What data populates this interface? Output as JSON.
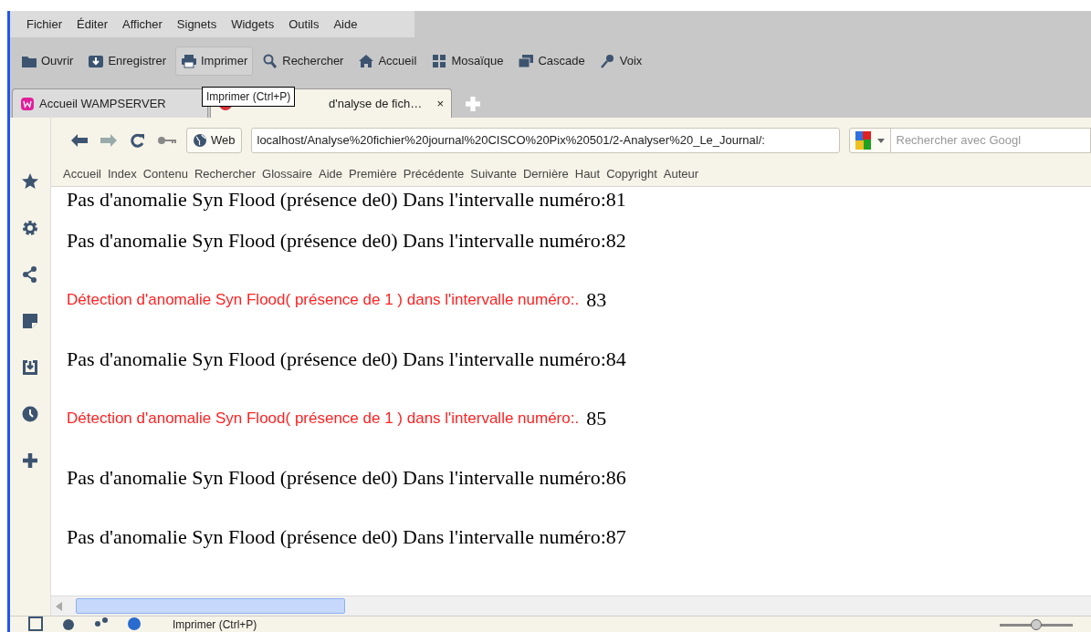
{
  "menu": [
    "Fichier",
    "Éditer",
    "Afficher",
    "Signets",
    "Widgets",
    "Outils",
    "Aide"
  ],
  "toolbar": [
    {
      "kind": "folder",
      "label": "Ouvrir",
      "hover": false
    },
    {
      "kind": "save",
      "label": "Enregistrer",
      "hover": false
    },
    {
      "kind": "print",
      "label": "Imprimer",
      "hover": true
    },
    {
      "kind": "search",
      "label": "Rechercher",
      "hover": false
    },
    {
      "kind": "home",
      "label": "Accueil",
      "hover": false
    },
    {
      "kind": "tile",
      "label": "Mosaïque",
      "hover": false
    },
    {
      "kind": "cascade",
      "label": "Cascade",
      "hover": false
    },
    {
      "kind": "voice",
      "label": "Voix",
      "hover": false
    }
  ],
  "tabs": [
    {
      "label": "Accueil WAMPSERVER",
      "selected": false
    },
    {
      "label": "d'nalyse de fich…",
      "selected": true,
      "close_glyph": "×"
    }
  ],
  "tooltip": "Imprimer (Ctrl+P)",
  "address_bar": {
    "site_label": "Web",
    "url": "localhost/Analyse%20fichier%20journal%20CISCO%20Pix%20501/2-Analyser%20_Le_Journal/:",
    "search_placeholder": "Rechercher avec Googl"
  },
  "link_bar": [
    "Accueil",
    "Index",
    "Contenu",
    "Rechercher",
    "Glossaire",
    "Aide",
    "Première",
    "Précédente",
    "Suivante",
    "Dernière",
    "Haut",
    "Copyright",
    "Auteur"
  ],
  "lines": [
    {
      "kind": "normal",
      "text": "Pas d'anomalie Syn Flood (présence de0) Dans l'intervalle numéro:81"
    },
    {
      "kind": "normal",
      "text": "Pas d'anomalie Syn Flood (présence de0) Dans l'intervalle numéro:82"
    },
    {
      "kind": "alert",
      "text": "Détection d'anomalie Syn Flood( présence de 1 ) dans l'intervalle numéro:.",
      "number": "83"
    },
    {
      "kind": "normal",
      "text": "Pas d'anomalie Syn Flood (présence de0) Dans l'intervalle numéro:84"
    },
    {
      "kind": "alert",
      "text": "Détection d'anomalie Syn Flood( présence de 1 ) dans l'intervalle numéro:.",
      "number": "85"
    },
    {
      "kind": "normal",
      "text": "Pas d'anomalie Syn Flood (présence de0) Dans l'intervalle numéro:86"
    },
    {
      "kind": "normal",
      "text": "Pas d'anomalie Syn Flood (présence de0) Dans l'intervalle numéro:87"
    }
  ],
  "status_bar": {
    "text": "Imprimer (Ctrl+P)",
    "zoom": {
      "level": 0.5
    }
  }
}
